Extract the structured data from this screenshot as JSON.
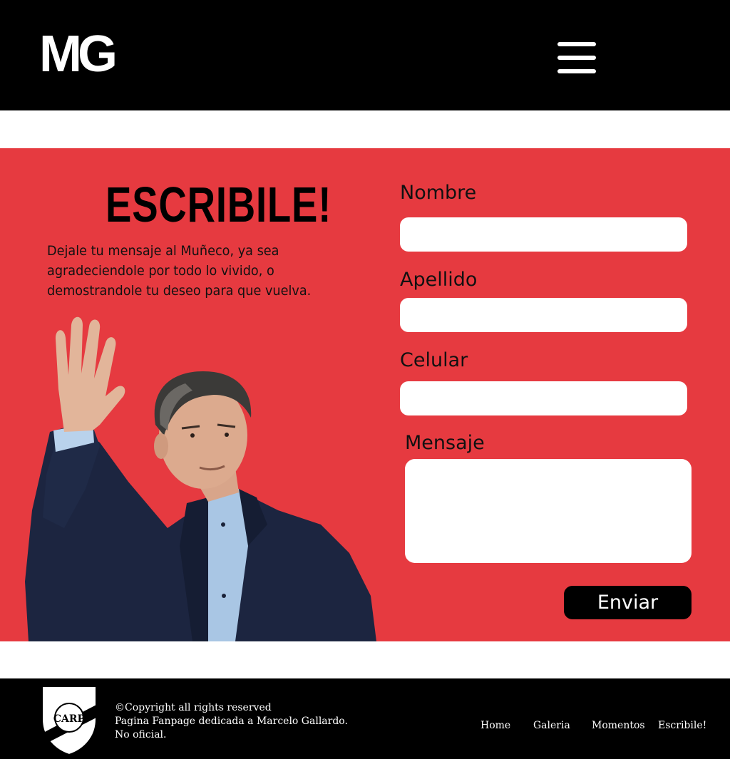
{
  "header": {
    "logo_text": "MG"
  },
  "contact": {
    "title": "ESCRIBILE!",
    "intro_text": "Dejale tu mensaje al Muñeco, ya sea agradeciendole por todo lo vivido, o demostrandole tu deseo para que vuelva.",
    "form": {
      "nombre_label": "Nombre",
      "apellido_label": "Apellido",
      "celular_label": "Celular",
      "mensaje_label": "Mensaje",
      "nombre_value": "",
      "apellido_value": "",
      "celular_value": "",
      "mensaje_value": "",
      "submit_label": "Enviar"
    }
  },
  "footer": {
    "copyright": "©Copyright all rights reserved",
    "description_line1": "Pagina Fanpage dedicada a Marcelo Gallardo.",
    "description_line2": "No oficial.",
    "crest_text": "CARP",
    "nav": [
      "Home",
      "Galeria",
      "Momentos",
      "Escribile!"
    ]
  },
  "colors": {
    "header_bg": "#000000",
    "section_bg": "#e63a40",
    "footer_bg": "#000000",
    "button_bg": "#000000",
    "field_bg": "#ffffff"
  }
}
